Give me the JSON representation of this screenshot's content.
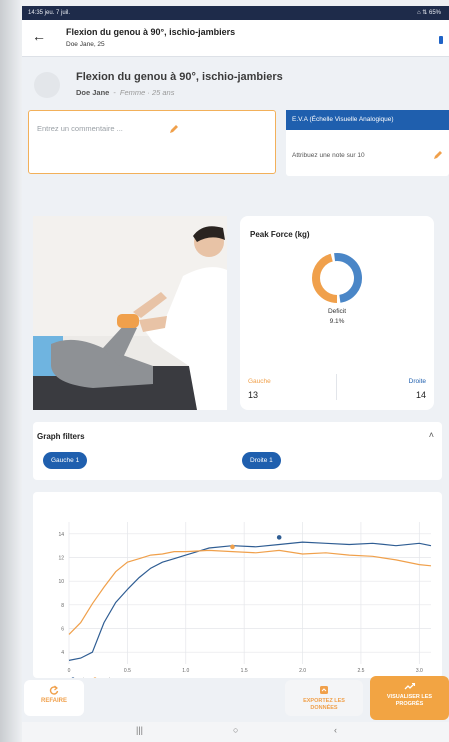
{
  "status_bar": {
    "time_date": "14:35 jeu. 7 juil.",
    "right": "⌂ ⇅ 65%"
  },
  "app_bar": {
    "title": "Flexion du genou à 90°, ischio-jambiers",
    "subtitle": "Doe Jane, 25"
  },
  "header": {
    "exercise_name": "Flexion du genou à 90°, ischio-jambiers",
    "patient_name": "Doe Jane",
    "separator": "-",
    "patient_meta": "Femme · 25 ans"
  },
  "comment": {
    "placeholder": "Entrez un commentaire ..."
  },
  "eva": {
    "title": "E.V.A (Échelle Visuelle Analogique)",
    "rate_prompt": "Attribuez une note sur 10"
  },
  "peak_force": {
    "title": "Peak Force (kg)",
    "deficit_label": "Deficit",
    "deficit_value": "9.1%",
    "deficit_pct": 9.1,
    "left_label": "Gauche",
    "left_value": "13",
    "right_label": "Droite",
    "right_value": "14"
  },
  "filters": {
    "title": "Graph filters",
    "chips": [
      "Gauche 1",
      "Droite 1"
    ]
  },
  "chart_data": {
    "type": "line",
    "title": "",
    "xlabel": "",
    "ylabel": "",
    "grid": true,
    "legend_position": "bottom-left",
    "legend": [
      "Droite",
      "Gauche"
    ],
    "x_ticks": [
      "0",
      "0.5",
      "1.0",
      "1.5",
      "2.0",
      "2.5",
      "3.0"
    ],
    "y_ticks": [
      "4",
      "6",
      "8",
      "10",
      "12",
      "14"
    ],
    "xlim": [
      0,
      3.1
    ],
    "ylim": [
      3,
      15
    ],
    "series": [
      {
        "name": "Droite",
        "color": "#2f5d93",
        "x": [
          0,
          0.1,
          0.2,
          0.3,
          0.4,
          0.5,
          0.6,
          0.7,
          0.8,
          0.9,
          1.0,
          1.1,
          1.2,
          1.4,
          1.6,
          1.8,
          2.0,
          2.2,
          2.4,
          2.6,
          2.8,
          3.0,
          3.1
        ],
        "y": [
          3.3,
          3.5,
          4.0,
          6.5,
          8.2,
          9.3,
          10.3,
          11.1,
          11.6,
          11.9,
          12.2,
          12.5,
          12.8,
          13.0,
          12.9,
          13.1,
          13.3,
          13.2,
          13.1,
          13.2,
          13.0,
          13.2,
          13.0
        ],
        "marker": {
          "x": 1.8,
          "y": 13.7
        }
      },
      {
        "name": "Gauche",
        "color": "#f0a04b",
        "x": [
          0,
          0.1,
          0.2,
          0.3,
          0.4,
          0.5,
          0.6,
          0.7,
          0.8,
          0.9,
          1.0,
          1.2,
          1.4,
          1.6,
          1.8,
          2.0,
          2.2,
          2.4,
          2.6,
          2.8,
          3.0,
          3.1
        ],
        "y": [
          5.5,
          6.5,
          8.1,
          9.5,
          10.8,
          11.6,
          11.9,
          12.2,
          12.3,
          12.5,
          12.5,
          12.6,
          12.5,
          12.4,
          12.6,
          12.3,
          12.4,
          12.2,
          12.1,
          11.8,
          11.4,
          11.3
        ],
        "marker": {
          "x": 1.4,
          "y": 12.9
        }
      }
    ]
  },
  "actions": {
    "redo": "REFAIRE",
    "export_line1": "EXPORTEZ LES",
    "export_line2": "DONNÉES",
    "progress_line1": "VISUALISER LES",
    "progress_line2": "PROGRÈS"
  },
  "nav": {
    "recent": "|||",
    "home": "○",
    "back": "‹"
  },
  "icons": {
    "back": "arrow-left-icon",
    "pencil": "pencil-icon",
    "redo": "redo-icon",
    "export": "export-icon",
    "progress": "trend-up-icon"
  },
  "colors": {
    "accent": "#f0a04b",
    "primary": "#1f5fae",
    "status_bar": "#1e2b4a"
  }
}
